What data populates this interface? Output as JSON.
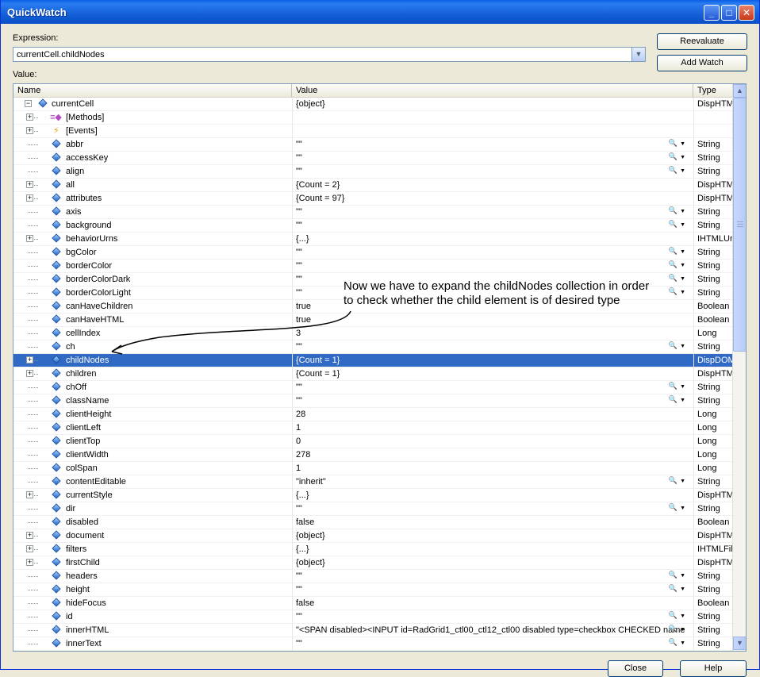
{
  "window": {
    "title": "QuickWatch"
  },
  "expression": {
    "label": "Expression:",
    "value": "currentCell.childNodes"
  },
  "value_label": "Value:",
  "buttons": {
    "reevaluate": "Reevaluate",
    "add_watch": "Add Watch",
    "close": "Close",
    "help": "Help"
  },
  "columns": {
    "name": "Name",
    "value": "Value",
    "type": "Type"
  },
  "annotation": {
    "line1": "Now we have to expand the childNodes collection in order",
    "line2": "to check whether the child element is of desired type"
  },
  "rows": [
    {
      "name": "currentCell",
      "value": "{object}",
      "type": "DispHTML",
      "icon": "object",
      "expand": "minus",
      "root": true
    },
    {
      "name": "[Methods]",
      "value": "",
      "type": "",
      "icon": "methods",
      "expand": "plus"
    },
    {
      "name": "[Events]",
      "value": "",
      "type": "",
      "icon": "events",
      "expand": "plus"
    },
    {
      "name": "abbr",
      "value": "\"\"",
      "type": "String",
      "icon": "prop",
      "lens": true
    },
    {
      "name": "accessKey",
      "value": "\"\"",
      "type": "String",
      "icon": "prop",
      "lens": true
    },
    {
      "name": "align",
      "value": "\"\"",
      "type": "String",
      "icon": "prop",
      "lens": true
    },
    {
      "name": "all",
      "value": "{Count = 2}",
      "type": "DispHTML",
      "icon": "prop",
      "expand": "plus"
    },
    {
      "name": "attributes",
      "value": "{Count = 97}",
      "type": "DispHTML",
      "icon": "prop",
      "expand": "plus"
    },
    {
      "name": "axis",
      "value": "\"\"",
      "type": "String",
      "icon": "prop",
      "lens": true
    },
    {
      "name": "background",
      "value": "\"\"",
      "type": "String",
      "icon": "prop",
      "lens": true
    },
    {
      "name": "behaviorUrns",
      "value": "{...}",
      "type": "IHTMLUrn",
      "icon": "prop",
      "expand": "plus"
    },
    {
      "name": "bgColor",
      "value": "\"\"",
      "type": "String",
      "icon": "prop",
      "lens": true
    },
    {
      "name": "borderColor",
      "value": "\"\"",
      "type": "String",
      "icon": "prop",
      "lens": true
    },
    {
      "name": "borderColorDark",
      "value": "\"\"",
      "type": "String",
      "icon": "prop",
      "lens": true
    },
    {
      "name": "borderColorLight",
      "value": "\"\"",
      "type": "String",
      "icon": "prop",
      "lens": true
    },
    {
      "name": "canHaveChildren",
      "value": "true",
      "type": "Boolean",
      "icon": "prop"
    },
    {
      "name": "canHaveHTML",
      "value": "true",
      "type": "Boolean",
      "icon": "prop"
    },
    {
      "name": "cellIndex",
      "value": "3",
      "type": "Long",
      "icon": "prop"
    },
    {
      "name": "ch",
      "value": "\"\"",
      "type": "String",
      "icon": "prop",
      "lens": true
    },
    {
      "name": "childNodes",
      "value": "{Count = 1}",
      "type": "DispDOMC",
      "icon": "prop",
      "expand": "plus",
      "selected": true
    },
    {
      "name": "children",
      "value": "{Count = 1}",
      "type": "DispHTML",
      "icon": "prop",
      "expand": "plus"
    },
    {
      "name": "chOff",
      "value": "\"\"",
      "type": "String",
      "icon": "prop",
      "lens": true
    },
    {
      "name": "className",
      "value": "\"\"",
      "type": "String",
      "icon": "prop",
      "lens": true
    },
    {
      "name": "clientHeight",
      "value": "28",
      "type": "Long",
      "icon": "prop"
    },
    {
      "name": "clientLeft",
      "value": "1",
      "type": "Long",
      "icon": "prop"
    },
    {
      "name": "clientTop",
      "value": "0",
      "type": "Long",
      "icon": "prop"
    },
    {
      "name": "clientWidth",
      "value": "278",
      "type": "Long",
      "icon": "prop"
    },
    {
      "name": "colSpan",
      "value": "1",
      "type": "Long",
      "icon": "prop"
    },
    {
      "name": "contentEditable",
      "value": "\"inherit\"",
      "type": "String",
      "icon": "prop",
      "lens": true
    },
    {
      "name": "currentStyle",
      "value": "{...}",
      "type": "DispHTML",
      "icon": "prop",
      "expand": "plus"
    },
    {
      "name": "dir",
      "value": "\"\"",
      "type": "String",
      "icon": "prop",
      "lens": true
    },
    {
      "name": "disabled",
      "value": "false",
      "type": "Boolean",
      "icon": "prop"
    },
    {
      "name": "document",
      "value": "{object}",
      "type": "DispHTML",
      "icon": "prop",
      "expand": "plus"
    },
    {
      "name": "filters",
      "value": "{...}",
      "type": "IHTMLFilte",
      "icon": "prop",
      "expand": "plus"
    },
    {
      "name": "firstChild",
      "value": "{object}",
      "type": "DispHTML",
      "icon": "prop",
      "expand": "plus"
    },
    {
      "name": "headers",
      "value": "\"\"",
      "type": "String",
      "icon": "prop",
      "lens": true
    },
    {
      "name": "height",
      "value": "\"\"",
      "type": "String",
      "icon": "prop",
      "lens": true
    },
    {
      "name": "hideFocus",
      "value": "false",
      "type": "Boolean",
      "icon": "prop"
    },
    {
      "name": "id",
      "value": "\"\"",
      "type": "String",
      "icon": "prop",
      "lens": true
    },
    {
      "name": "innerHTML",
      "value": "\"<SPAN disabled><INPUT id=RadGrid1_ctl00_ctl12_ctl00 disabled type=checkbox CHECKED name",
      "type": "String",
      "icon": "prop",
      "lens": true
    },
    {
      "name": "innerText",
      "value": "\"\"",
      "type": "String",
      "icon": "prop",
      "lens": true
    }
  ]
}
